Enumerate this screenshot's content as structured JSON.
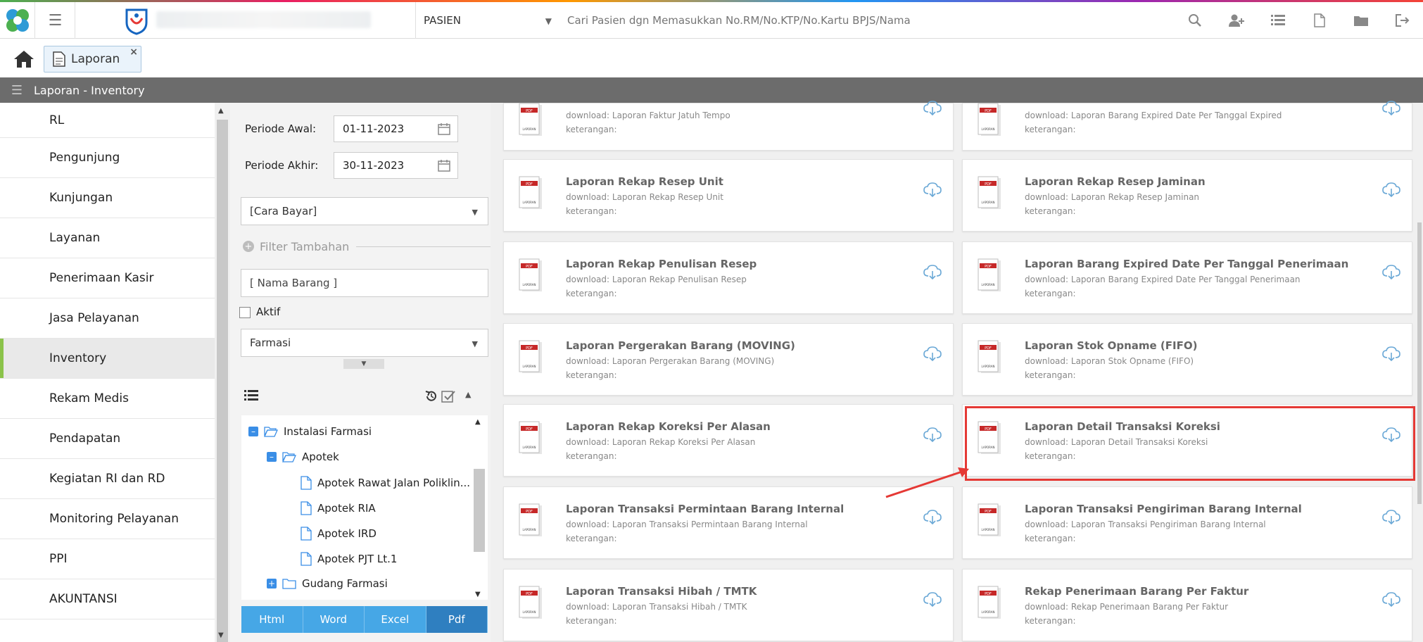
{
  "topbar": {
    "patient_select": "PASIEN",
    "search_placeholder": "Cari Pasien dgn Memasukkan No.RM/No.KTP/No.Kartu BPJS/Nama"
  },
  "tabs": [
    {
      "label": "Laporan"
    }
  ],
  "page_title": "Laporan - Inventory",
  "sidebar": {
    "items": [
      "RL",
      "Pengunjung",
      "Kunjungan",
      "Layanan",
      "Penerimaan Kasir",
      "Jasa Pelayanan",
      "Inventory",
      "Rekam Medis",
      "Pendapatan",
      "Kegiatan RI dan RD",
      "Monitoring Pelayanan",
      "PPI",
      "AKUNTANSI"
    ],
    "active": "Inventory"
  },
  "filters": {
    "periode_awal_label": "Periode Awal:",
    "periode_awal": "01-11-2023",
    "periode_akhir_label": "Periode Akhir:",
    "periode_akhir": "30-11-2023",
    "cara_bayar": "[Cara Bayar]",
    "filter_tambahan": "Filter Tambahan",
    "nama_barang": "[ Nama Barang ]",
    "aktif_label": "Aktif",
    "unit": "Farmasi"
  },
  "tree": {
    "nodes": [
      {
        "label": "Instalasi Farmasi"
      },
      {
        "label": "Apotek"
      },
      {
        "label": "Apotek Rawat Jalan Poliklin..."
      },
      {
        "label": "Apotek RIA"
      },
      {
        "label": "Apotek IRD"
      },
      {
        "label": "Apotek PJT Lt.1"
      },
      {
        "label": "Gudang Farmasi"
      }
    ]
  },
  "export_buttons": [
    "Html",
    "Word",
    "Excel",
    "Pdf"
  ],
  "export_active": "Pdf",
  "reports": {
    "keterangan": "keterangan:",
    "download_prefix": "download: ",
    "left": [
      {
        "title": "",
        "download": "Laporan Faktur Jatuh Tempo"
      },
      {
        "title": "Laporan Rekap Resep Unit",
        "download": "Laporan Rekap Resep Unit"
      },
      {
        "title": "Laporan Rekap Penulisan Resep",
        "download": "Laporan Rekap Penulisan Resep"
      },
      {
        "title": "Laporan Pergerakan Barang (MOVING)",
        "download": "Laporan Pergerakan Barang (MOVING)"
      },
      {
        "title": "Laporan Rekap Koreksi Per Alasan",
        "download": "Laporan Rekap Koreksi Per Alasan"
      },
      {
        "title": "Laporan Transaksi Permintaan Barang Internal",
        "download": "Laporan Transaksi Permintaan Barang Internal"
      },
      {
        "title": "Laporan Transaksi Hibah / TMTK",
        "download": "Laporan Transaksi Hibah / TMTK"
      }
    ],
    "right": [
      {
        "title": "",
        "download": "Laporan Barang Expired Date Per Tanggal Expired"
      },
      {
        "title": "Laporan Rekap Resep Jaminan",
        "download": "Laporan Rekap Resep Jaminan"
      },
      {
        "title": "Laporan Barang Expired Date Per Tanggal Penerimaan",
        "download": "Laporan Barang Expired Date Per Tanggal Penerimaan"
      },
      {
        "title": "Laporan Stok Opname (FIFO)",
        "download": "Laporan Stok Opname (FIFO)"
      },
      {
        "title": "Laporan Detail Transaksi Koreksi",
        "download": "Laporan Detail Transaksi Koreksi"
      },
      {
        "title": "Laporan Transaksi Pengiriman Barang Internal",
        "download": "Laporan Transaksi Pengiriman Barang Internal"
      },
      {
        "title": "Rekap Penerimaan Barang Per Faktur",
        "download": "Rekap Penerimaan Barang Per Faktur"
      }
    ]
  },
  "colors": {
    "accent": "#46a7e6",
    "highlight": "#e53935",
    "active_marker": "#8bc34a",
    "titlebar": "#6c6c6c"
  },
  "icons": [
    "app-logo-icon",
    "menu-icon",
    "search-icon",
    "add-user-icon",
    "list-icon",
    "pdf-file-icon",
    "folder-icon",
    "logout-icon",
    "home-icon",
    "document-icon",
    "calendar-icon",
    "cloud-download-icon",
    "report-file-icon"
  ]
}
